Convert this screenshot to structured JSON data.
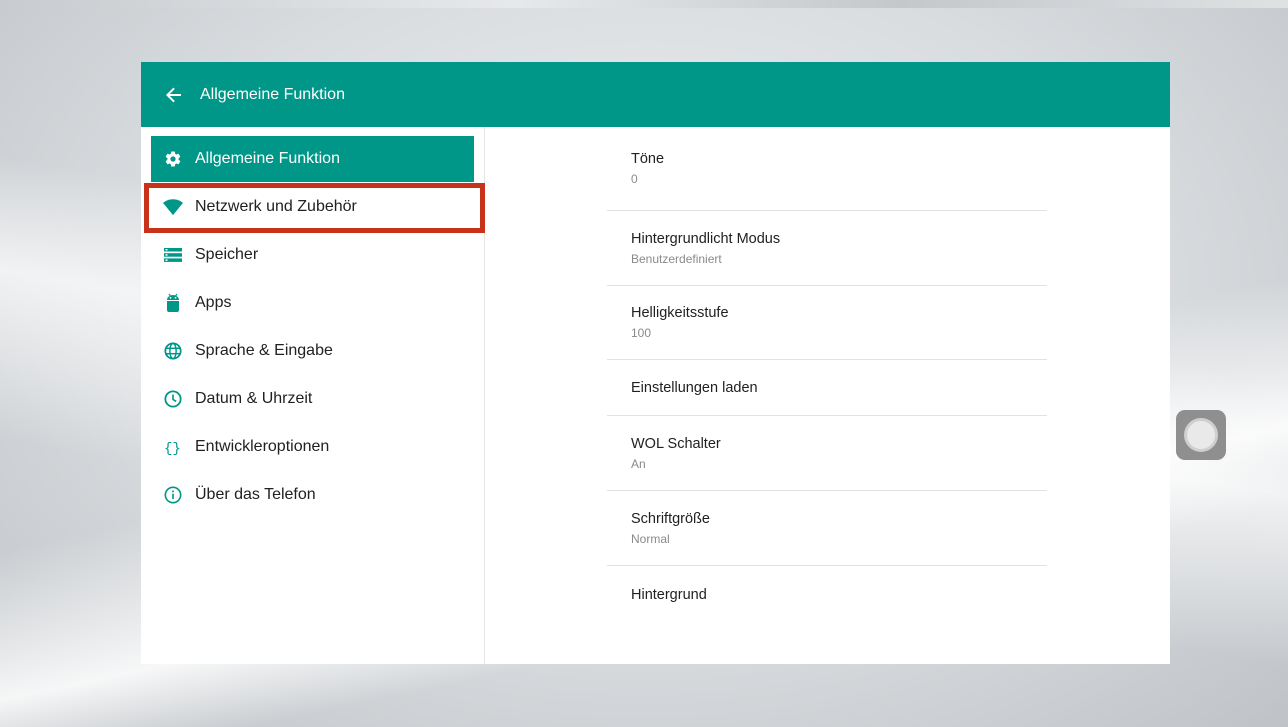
{
  "app_bar": {
    "title": "Allgemeine Funktion"
  },
  "sidebar": {
    "items": [
      {
        "label": "Allgemeine Funktion",
        "icon": "gear-icon",
        "selected": true
      },
      {
        "label": "Netzwerk und Zubehör",
        "icon": "wifi-icon",
        "selected": false,
        "highlighted": true
      },
      {
        "label": "Speicher",
        "icon": "storage-icon",
        "selected": false
      },
      {
        "label": "Apps",
        "icon": "android-icon",
        "selected": false
      },
      {
        "label": "Sprache & Eingabe",
        "icon": "globe-icon",
        "selected": false
      },
      {
        "label": "Datum & Uhrzeit",
        "icon": "clock-icon",
        "selected": false
      },
      {
        "label": "Entwickleroptionen",
        "icon": "braces-icon",
        "selected": false
      },
      {
        "label": "Über das Telefon",
        "icon": "info-icon",
        "selected": false
      }
    ]
  },
  "settings": [
    {
      "title": "Töne",
      "summary": "0"
    },
    {
      "title": "Hintergrundlicht Modus",
      "summary": "Benutzerdefiniert"
    },
    {
      "title": "Helligkeitsstufe",
      "summary": "100"
    },
    {
      "title": "Einstellungen laden",
      "summary": ""
    },
    {
      "title": "WOL Schalter",
      "summary": "An"
    },
    {
      "title": "Schriftgröße",
      "summary": "Normal"
    },
    {
      "title": "Hintergrund",
      "summary": ""
    }
  ],
  "colors": {
    "accent": "#009688",
    "highlight_border": "#c8321a"
  },
  "floating_button": {
    "icon": "assistive-touch-icon"
  }
}
